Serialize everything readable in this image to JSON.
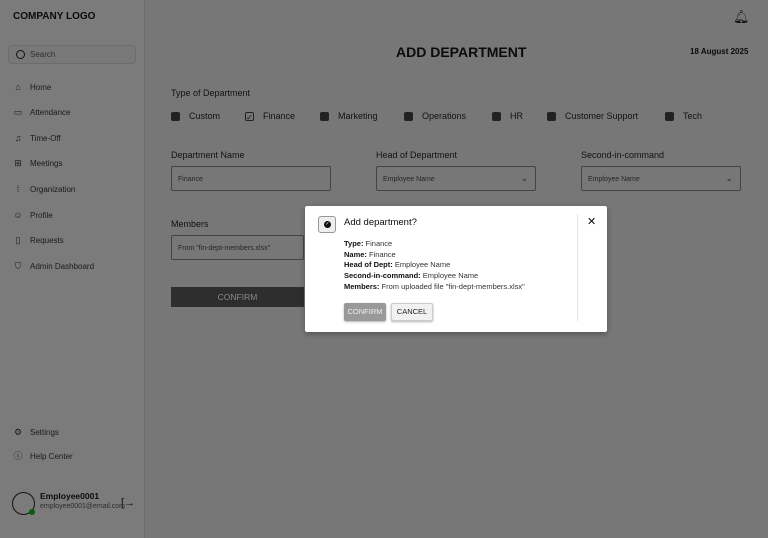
{
  "sidebar": {
    "logo": "COMPANY LOGO",
    "search_placeholder": "Search",
    "items": [
      {
        "label": "Home",
        "icon": "home-icon"
      },
      {
        "label": "Attendance",
        "icon": "calendar-icon"
      },
      {
        "label": "Time-Off",
        "icon": "bell-icon"
      },
      {
        "label": "Meetings",
        "icon": "video-icon"
      },
      {
        "label": "Organization",
        "icon": "grid-icon"
      },
      {
        "label": "Profile",
        "icon": "user-icon"
      },
      {
        "label": "Requests",
        "icon": "document-icon"
      },
      {
        "label": "Admin Dashboard",
        "icon": "shield-icon"
      }
    ],
    "bottom": [
      {
        "label": "Settings",
        "icon": "gear-icon"
      },
      {
        "label": "Help Center",
        "icon": "help-icon"
      }
    ],
    "user": {
      "name": "Employee0001",
      "email": "employee0001@email.com",
      "status_color": "#0a7a1e"
    }
  },
  "header": {
    "title": "ADD DEPARTMENT",
    "date": "18 August 2025"
  },
  "form": {
    "type_label": "Type of Department",
    "types": [
      {
        "label": "Custom",
        "checked": false
      },
      {
        "label": "Finance",
        "checked": true
      },
      {
        "label": "Marketing",
        "checked": false
      },
      {
        "label": "Operations",
        "checked": false
      },
      {
        "label": "HR",
        "checked": false
      },
      {
        "label": "Customer Support",
        "checked": false
      },
      {
        "label": "Tech",
        "checked": false
      }
    ],
    "name_label": "Department Name",
    "name_value": "Finance",
    "head_label": "Head of Department",
    "head_value": "Employee Name",
    "second_label": "Second-in-command",
    "second_value": "Employee Name",
    "members_label": "Members",
    "members_value": "From \"fin-dept-members.xlsx\"",
    "confirm": "CONFIRM"
  },
  "modal": {
    "title": "Add department?",
    "rows": [
      {
        "k": "Type:",
        "v": " Finance"
      },
      {
        "k": "Name:",
        "v": " Finance"
      },
      {
        "k": "Head of Dept:",
        "v": " Employee Name"
      },
      {
        "k": "Second-in-command:",
        "v": " Employee Name"
      },
      {
        "k": "Members:",
        "v": " From uploaded file \"fin-dept-members.xlsx\""
      }
    ],
    "confirm": "CONFIRM",
    "cancel": "CANCEL"
  }
}
